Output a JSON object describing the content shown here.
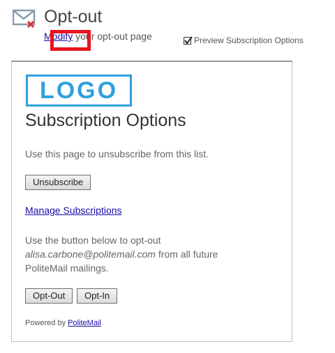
{
  "header": {
    "title": "Opt-out",
    "modify_link": "Modify",
    "modify_suffix": " your opt-out page",
    "preview_checkbox_label": "Preview Subscription Options",
    "preview_checked": true
  },
  "panel": {
    "logo_text": "LOGO",
    "title": "Subscription Options",
    "intro_text": "Use this page to unsubscribe from this list.",
    "unsubscribe_label": "Unsubscribe",
    "manage_link": "Manage Subscriptions",
    "optout_text_1": "Use the button below to opt-out",
    "email": "alisa.carbone@politemail.com",
    "optout_text_2": " from all future",
    "optout_text_3": "PoliteMail mailings.",
    "optout_label": "Opt-Out",
    "optin_label": "Opt-In",
    "powered_by_prefix": "Powered by ",
    "powered_by_link": "PoliteMail"
  },
  "colors": {
    "highlight": "#e8141d",
    "logo": "#2fa0dc",
    "link": "#1a0dab",
    "envelope": "#8a9bb0",
    "envelope_x": "#e03030"
  },
  "icons": {
    "envelope": "envelope-optout-icon",
    "checkmark": "checkmark-icon"
  }
}
